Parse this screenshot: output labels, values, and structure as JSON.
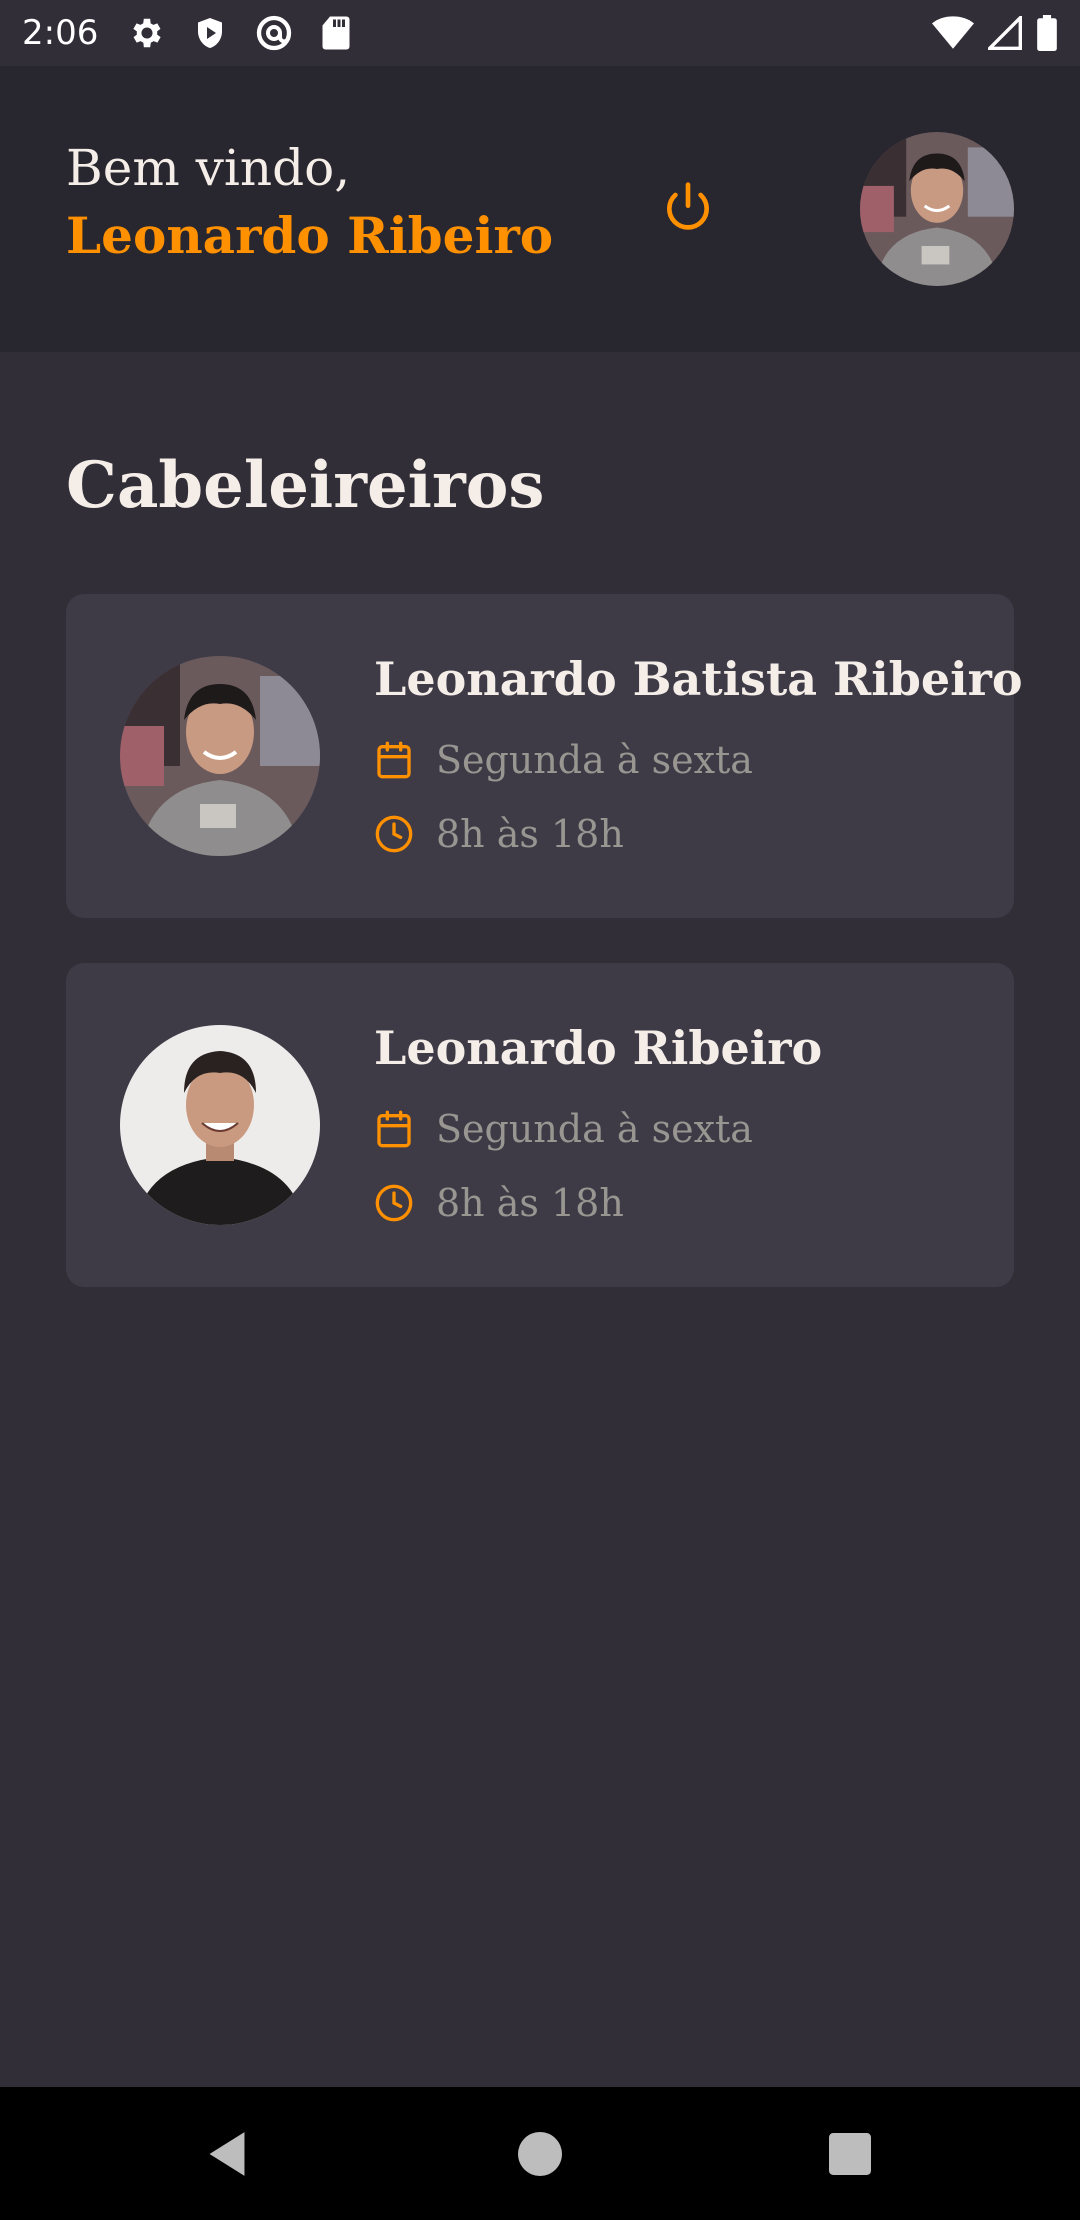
{
  "status_bar": {
    "time": "2:06",
    "left_icons": [
      "settings-gear-icon",
      "shield-icon",
      "at-sign-icon",
      "sd-card-icon"
    ],
    "right_icons": [
      "wifi-icon",
      "cellular-signal-icon",
      "battery-icon"
    ]
  },
  "header": {
    "greeting_label": "Bem vindo,",
    "user_name": "Leonardo Ribeiro",
    "logout_icon": "power-icon",
    "accent_color": "#ff9000"
  },
  "main": {
    "section_title": "Cabeleireiros",
    "providers": [
      {
        "name": "Leonardo Batista Ribeiro",
        "days": "Segunda à sexta",
        "hours": "8h às 18h"
      },
      {
        "name": "Leonardo Ribeiro",
        "days": "Segunda à sexta",
        "hours": "8h às 18h"
      }
    ]
  },
  "nav_bar": {
    "buttons": [
      "back-icon",
      "home-icon",
      "recents-icon"
    ]
  },
  "colors": {
    "background": "#312e38",
    "header_background": "#28262e",
    "card_background": "#3e3b47",
    "accent": "#ff9000",
    "text_primary": "#f4ede8",
    "text_secondary": "#999591"
  }
}
